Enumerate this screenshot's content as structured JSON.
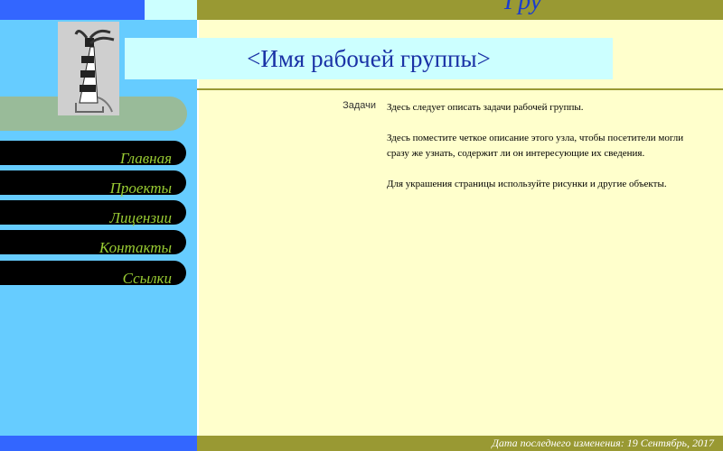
{
  "header": {
    "title": "<Имя рабочей группы>"
  },
  "nav": {
    "items": [
      "Главная",
      "Проекты",
      "Лицензии",
      "Контакты",
      "Ссылки"
    ]
  },
  "main": {
    "tasks_label": "Задачи",
    "paragraphs": [
      "Здесь следует описать задачи рабочей группы.",
      "Здесь поместите четкое описание этого узла, чтобы посетители могли сразу же узнать, содержит ли он интересующие их сведения.",
      "Для украшения страницы используйте рисунки и другие объекты."
    ]
  },
  "footer": {
    "last_modified": "Дата последнего изменения: 19 Сентябрь, 2017"
  },
  "colors": {
    "top_blue": "#3366ff",
    "olive": "#999933",
    "sidebar": "#66ccff",
    "main_bg": "#ffffcc",
    "title_box": "#ccffff",
    "title_text": "#1a32a6",
    "nav_text": "#99cc33"
  }
}
